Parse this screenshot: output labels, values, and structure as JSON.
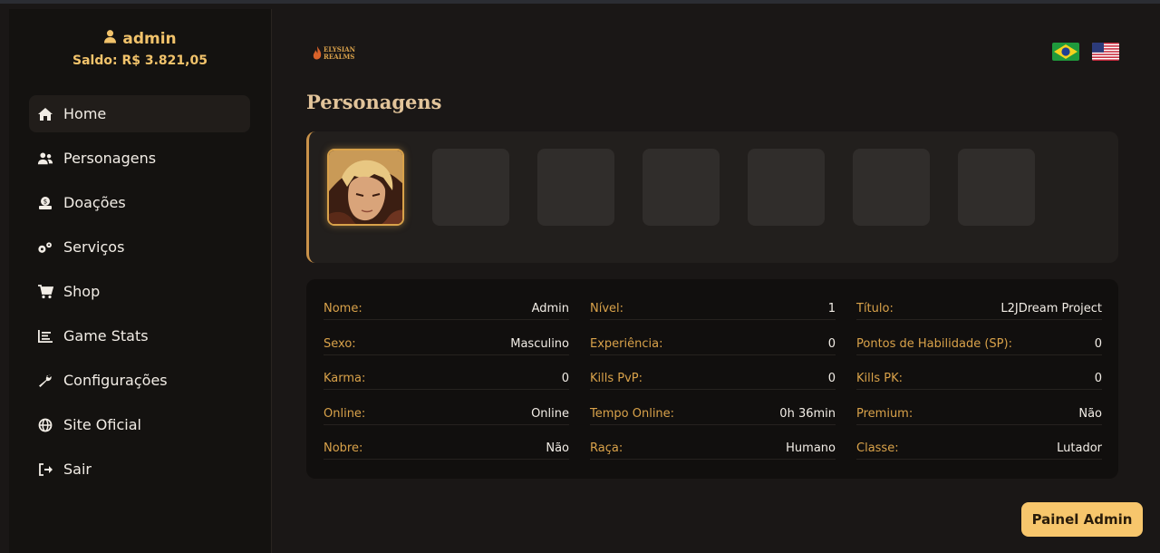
{
  "user": {
    "name": "admin",
    "balance": "Saldo: R$ 3.821,05"
  },
  "nav": [
    {
      "label": "Home",
      "icon": "home-icon",
      "active": true
    },
    {
      "label": "Personagens",
      "icon": "users-icon"
    },
    {
      "label": "Doações",
      "icon": "donation-icon"
    },
    {
      "label": "Serviços",
      "icon": "gears-icon"
    },
    {
      "label": "Shop",
      "icon": "cart-icon"
    },
    {
      "label": "Game Stats",
      "icon": "chart-icon"
    },
    {
      "label": "Configurações",
      "icon": "wrench-icon"
    },
    {
      "label": "Site Oficial",
      "icon": "globe-icon"
    },
    {
      "label": "Sair",
      "icon": "logout-icon"
    }
  ],
  "logo": {
    "line1": "ELYSIAN",
    "line2": "REALMS"
  },
  "page_title": "Personagens",
  "character_slots": 7,
  "info": {
    "nome": {
      "label": "Nome:",
      "value": "Admin"
    },
    "nivel": {
      "label": "Nível:",
      "value": "1"
    },
    "titulo": {
      "label": "Título:",
      "value": "L2JDream Project"
    },
    "sexo": {
      "label": "Sexo:",
      "value": "Masculino"
    },
    "experiencia": {
      "label": "Experiência:",
      "value": "0"
    },
    "sp": {
      "label": "Pontos de Habilidade (SP):",
      "value": "0"
    },
    "karma": {
      "label": "Karma:",
      "value": "0"
    },
    "pvp": {
      "label": "Kills PvP:",
      "value": "0"
    },
    "pk": {
      "label": "Kills PK:",
      "value": "0"
    },
    "online": {
      "label": "Online:",
      "value": "Online"
    },
    "tempo": {
      "label": "Tempo Online:",
      "value": "0h 36min"
    },
    "premium": {
      "label": "Premium:",
      "value": "Não"
    },
    "nobre": {
      "label": "Nobre:",
      "value": "Não"
    },
    "raca": {
      "label": "Raça:",
      "value": "Humano"
    },
    "classe": {
      "label": "Classe:",
      "value": "Lutador"
    }
  },
  "admin_button": "Painel Admin",
  "colors": {
    "accent": "#d9a24a",
    "button": "#f7c66c",
    "background": "#1a1716"
  }
}
